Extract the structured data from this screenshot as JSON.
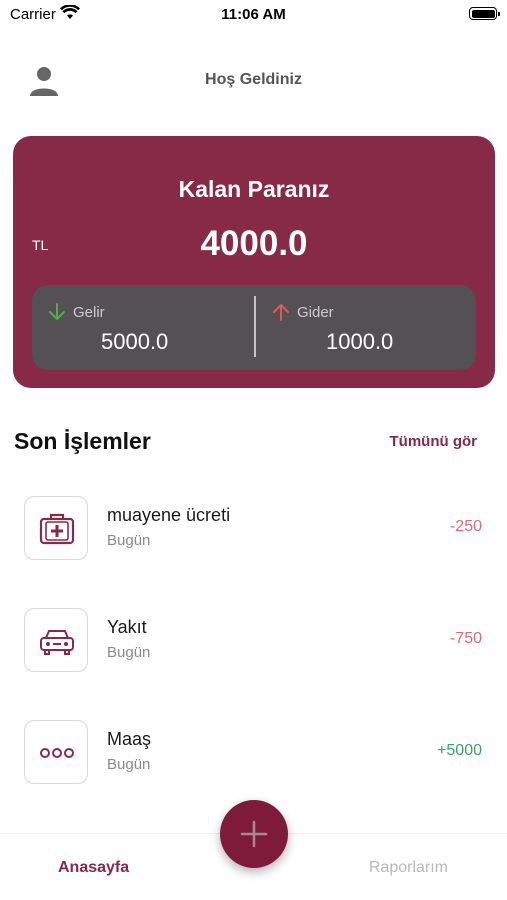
{
  "status_bar": {
    "carrier": "Carrier",
    "time": "11:06 AM"
  },
  "header": {
    "greeting": "Hoş Geldiniz",
    "avatar_icon": "person-icon"
  },
  "balance": {
    "title": "Kalan Paranız",
    "currency": "TL",
    "amount": "4000.0",
    "income": {
      "label": "Gelir",
      "value": "5000.0",
      "icon": "arrow-down-icon",
      "icon_color": "#4caf50"
    },
    "expense": {
      "label": "Gider",
      "value": "1000.0",
      "icon": "arrow-up-icon",
      "icon_color": "#e05a5a"
    },
    "card_color": "#862a47"
  },
  "recent": {
    "title": "Son İşlemler",
    "see_all": "Tümünü gör",
    "items": [
      {
        "icon": "medical-kit-icon",
        "title": "muayene ücreti",
        "date": "Bugün",
        "amount": "-250",
        "type": "expense"
      },
      {
        "icon": "car-icon",
        "title": "Yakıt",
        "date": "Bugün",
        "amount": "-750",
        "type": "expense"
      },
      {
        "icon": "more-icon",
        "title": "Maaş",
        "date": "Bugün",
        "amount": "+5000",
        "type": "income"
      }
    ]
  },
  "colors": {
    "accent": "#862a47",
    "expense": "#e06c72",
    "income": "#3fa163"
  },
  "nav": {
    "home": "Anasayfa",
    "reports": "Raporlarım",
    "fab_icon": "plus-icon"
  }
}
